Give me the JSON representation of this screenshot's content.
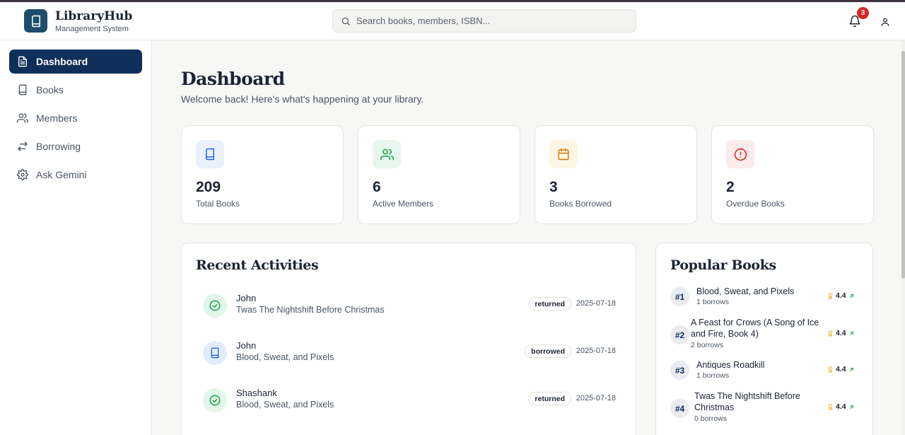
{
  "header": {
    "app_name": "LibraryHub",
    "app_subtitle": "Management System",
    "search_placeholder": "Search books, members, ISBN...",
    "notification_count": "3"
  },
  "sidebar": {
    "items": [
      {
        "label": "Dashboard",
        "icon": "document-icon",
        "active": true
      },
      {
        "label": "Books",
        "icon": "book-icon",
        "active": false
      },
      {
        "label": "Members",
        "icon": "users-icon",
        "active": false
      },
      {
        "label": "Borrowing",
        "icon": "arrows-swap-icon",
        "active": false
      },
      {
        "label": "Ask Gemini",
        "icon": "gear-icon",
        "active": false
      }
    ]
  },
  "page": {
    "title": "Dashboard",
    "subtitle": "Welcome back! Here's what's happening at your library."
  },
  "stats": [
    {
      "value": "209",
      "label": "Total Books",
      "icon": "book-icon",
      "color": "#2563eb",
      "bg": "#eaf1fd"
    },
    {
      "value": "6",
      "label": "Active Members",
      "icon": "users-icon",
      "color": "#16a34a",
      "bg": "#e8f7ee"
    },
    {
      "value": "3",
      "label": "Books Borrowed",
      "icon": "calendar-icon",
      "color": "#d97706",
      "bg": "#fdf5e3"
    },
    {
      "value": "2",
      "label": "Overdue Books",
      "icon": "alert-circle-icon",
      "color": "#dc2626",
      "bg": "#fcebeb"
    }
  ],
  "recent_activities": {
    "title": "Recent Activities",
    "items": [
      {
        "name": "John",
        "book": "Twas The Nightshift Before Christmas",
        "status": "returned",
        "date": "2025-07-18",
        "icon": "check-circle-icon"
      },
      {
        "name": "John",
        "book": "Blood, Sweat, and Pixels",
        "status": "borrowed",
        "date": "2025-07-18",
        "icon": "book-icon"
      },
      {
        "name": "Shashank",
        "book": "Blood, Sweat, and Pixels",
        "status": "returned",
        "date": "2025-07-18",
        "icon": "check-circle-icon"
      }
    ]
  },
  "popular_books": {
    "title": "Popular Books",
    "items": [
      {
        "rank": "#1",
        "title": "Blood, Sweat, and Pixels",
        "borrows": "1 borrows",
        "rating": "4.4"
      },
      {
        "rank": "#2",
        "title": "A Feast for Crows (A Song of Ice and Fire, Book 4)",
        "borrows": "2 borrows",
        "rating": "4.4"
      },
      {
        "rank": "#3",
        "title": "Antiques Roadkill",
        "borrows": "1 borrows",
        "rating": "4.4"
      },
      {
        "rank": "#4",
        "title": "Twas The Nightshift Before Christmas",
        "borrows": "0 borrows",
        "rating": "4.4"
      }
    ]
  }
}
